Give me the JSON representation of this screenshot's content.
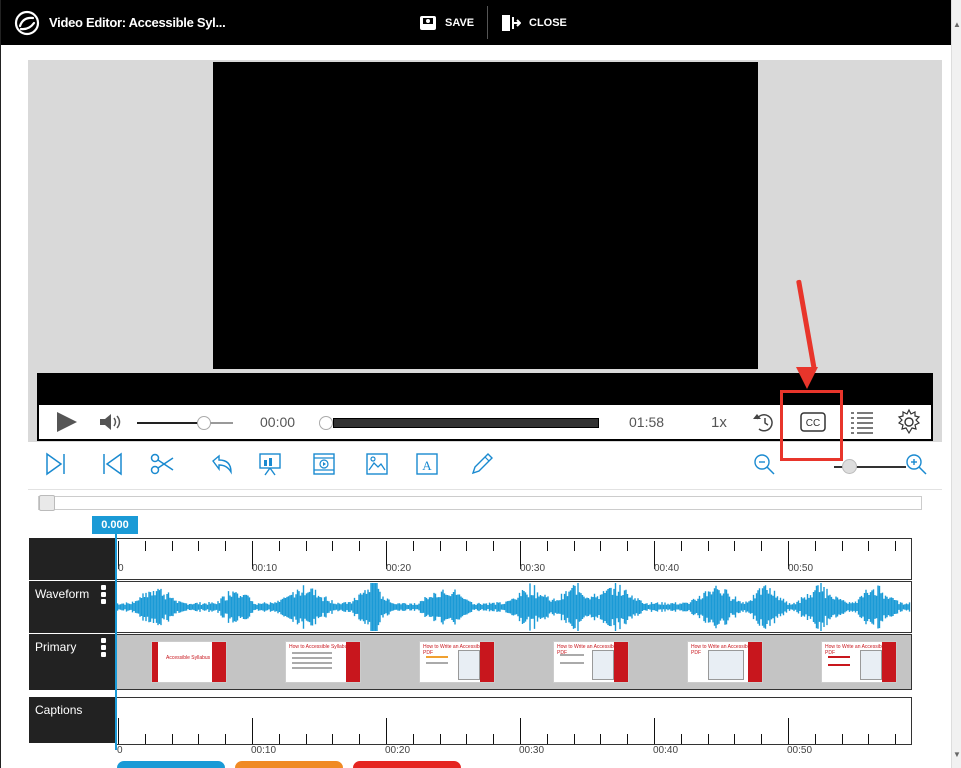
{
  "window": {
    "title": "Video Editor: Accessible Syl...",
    "save_label": "SAVE",
    "close_label": "CLOSE"
  },
  "player": {
    "current_time": "00:00",
    "duration": "01:58",
    "speed": "1x",
    "volume_level": 0.67,
    "progress": 0.0
  },
  "icons": {
    "logo": "app-logo-icon",
    "play": "play-icon",
    "volume": "volume-icon",
    "replay": "replay-icon",
    "cc": "closed-captions-icon",
    "chapters": "list-icon",
    "settings": "gear-icon"
  },
  "editor": {
    "tools": [
      "split-icon",
      "previous-icon",
      "scissors-icon",
      "undo-icon",
      "presentation-icon",
      "video-icon",
      "image-icon",
      "text-icon",
      "pen-icon"
    ],
    "zoom_level": 0.2
  },
  "timeline": {
    "playhead": "0.000",
    "ruler_labels": [
      "0",
      "00:10",
      "00:20",
      "00:30",
      "00:40",
      "00:50"
    ],
    "tracks": {
      "waveform": "Waveform",
      "primary": "Primary",
      "captions": "Captions"
    },
    "slides": [
      {
        "title": "Accessible Syllabus"
      },
      {
        "title": "How to Accessible Syllabus"
      },
      {
        "title": "How to Write an Accessible PDF"
      },
      {
        "title": "How to Write an Accessible PDF"
      },
      {
        "title": "How to Write an Accessible PDF"
      },
      {
        "title": "How to Write an Accessible PDF"
      }
    ]
  },
  "colors": {
    "accent": "#1a9ad6",
    "highlight": "#e8352b",
    "topbar": "#000000",
    "slide_red": "#c8161d"
  }
}
